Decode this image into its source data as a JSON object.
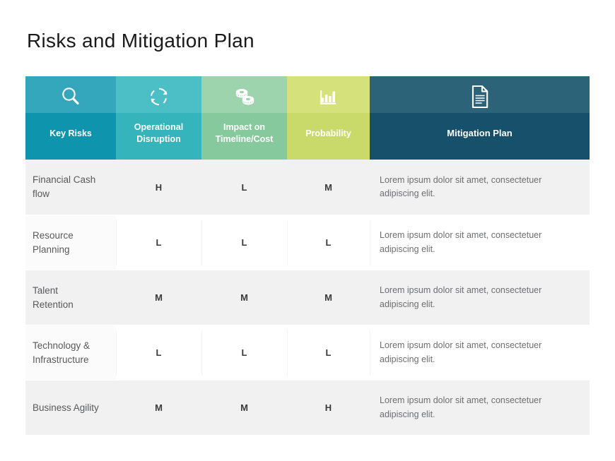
{
  "page_title": "Risks and Mitigation Plan",
  "colors": {
    "col_key_risks_light": "#35a7bd",
    "col_key_risks_dark": "#0f94ae",
    "col_operational_light": "#4cbfc6",
    "col_operational_dark": "#35b4bb",
    "col_impact_light": "#9ed4ad",
    "col_impact_dark": "#86c99c",
    "col_probability_light": "#d5e17a",
    "col_probability_dark": "#cada6a",
    "col_mitigation_light": "#2d6378",
    "col_mitigation_dark": "#17506a",
    "row_shaded": "#f1f1f1",
    "row_plain": "#ffffff",
    "title_text": "#1a1a1a",
    "risk_text": "#58595b",
    "rating_text": "#3a3a3a",
    "mitigation_text": "#6d6e71"
  },
  "table": {
    "headers": [
      {
        "label": "Key Risks",
        "icon": "magnifier-icon"
      },
      {
        "label": "Operational\nDisruption",
        "line1": "Operational",
        "line2": "Disruption",
        "icon": "refresh-cycle-icon"
      },
      {
        "label": "Impact on\nTimeline/Cost",
        "line1": "Impact on",
        "line2": "Timeline/Cost",
        "icon": "measuring-tape-icon"
      },
      {
        "label": "Probability",
        "icon": "bar-chart-icon"
      },
      {
        "label": "Mitigation Plan",
        "icon": "document-icon"
      }
    ],
    "rows": [
      {
        "risk_line1": "Financial Cash",
        "risk_line2": "flow",
        "operational": "H",
        "impact": "L",
        "probability": "M",
        "mitigation": "Lorem ipsum dolor sit amet, consectetuer adipiscing elit."
      },
      {
        "risk_line1": "Resource",
        "risk_line2": "Planning",
        "operational": "L",
        "impact": "L",
        "probability": "L",
        "mitigation": "Lorem ipsum dolor sit amet, consectetuer adipiscing elit."
      },
      {
        "risk_line1": "Talent",
        "risk_line2": "Retention",
        "operational": "M",
        "impact": "M",
        "probability": "M",
        "mitigation": "Lorem ipsum dolor sit amet, consectetuer adipiscing elit."
      },
      {
        "risk_line1": "Technology &",
        "risk_line2": "Infrastructure",
        "operational": "L",
        "impact": "L",
        "probability": "L",
        "mitigation": "Lorem ipsum dolor sit amet, consectetuer adipiscing elit."
      },
      {
        "risk_line1": "Business Agility",
        "risk_line2": "",
        "operational": "M",
        "impact": "M",
        "probability": "H",
        "mitigation": "Lorem ipsum dolor sit amet, consectetuer adipiscing elit."
      }
    ]
  }
}
